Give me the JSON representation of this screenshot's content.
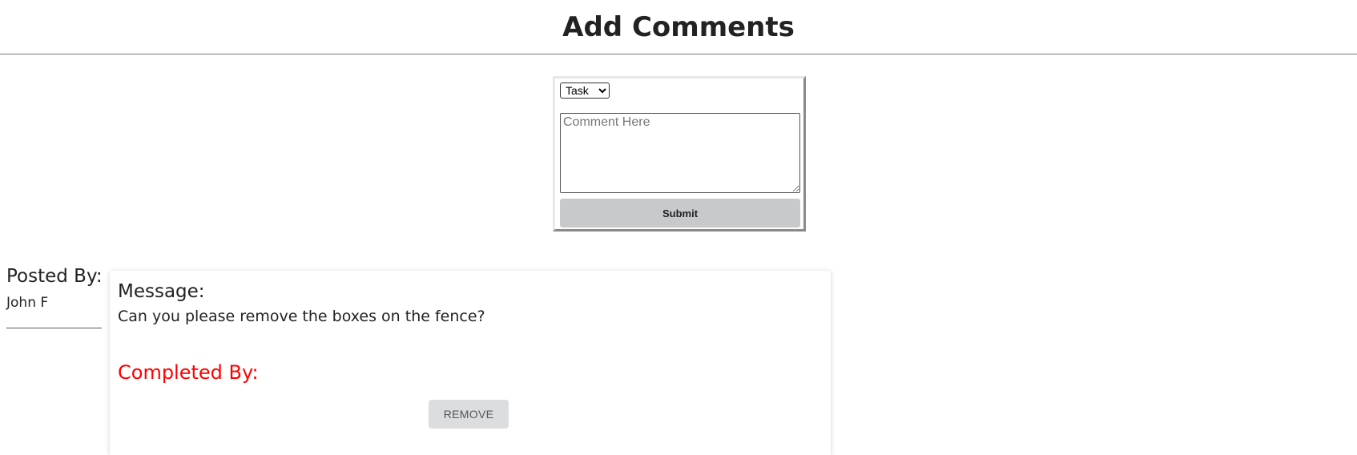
{
  "header": {
    "title": "Add Comments"
  },
  "comment_form": {
    "type_select": {
      "selected": "Task",
      "options": [
        "Task"
      ]
    },
    "comment_input": {
      "value": "",
      "placeholder": "Comment Here"
    },
    "submit_label": "Submit"
  },
  "comments": [
    {
      "posted_by_label": "Posted By:",
      "author": "John F",
      "message_label": "Message:",
      "message": "Can you please remove the boxes on the fence?",
      "completed_by_label": "Completed By:",
      "remove_label": "REMOVE"
    }
  ],
  "colors": {
    "completed_heading": "#ff0000",
    "submit_button_bg": "#c8c9cb",
    "remove_button_bg": "#dcdddf"
  }
}
